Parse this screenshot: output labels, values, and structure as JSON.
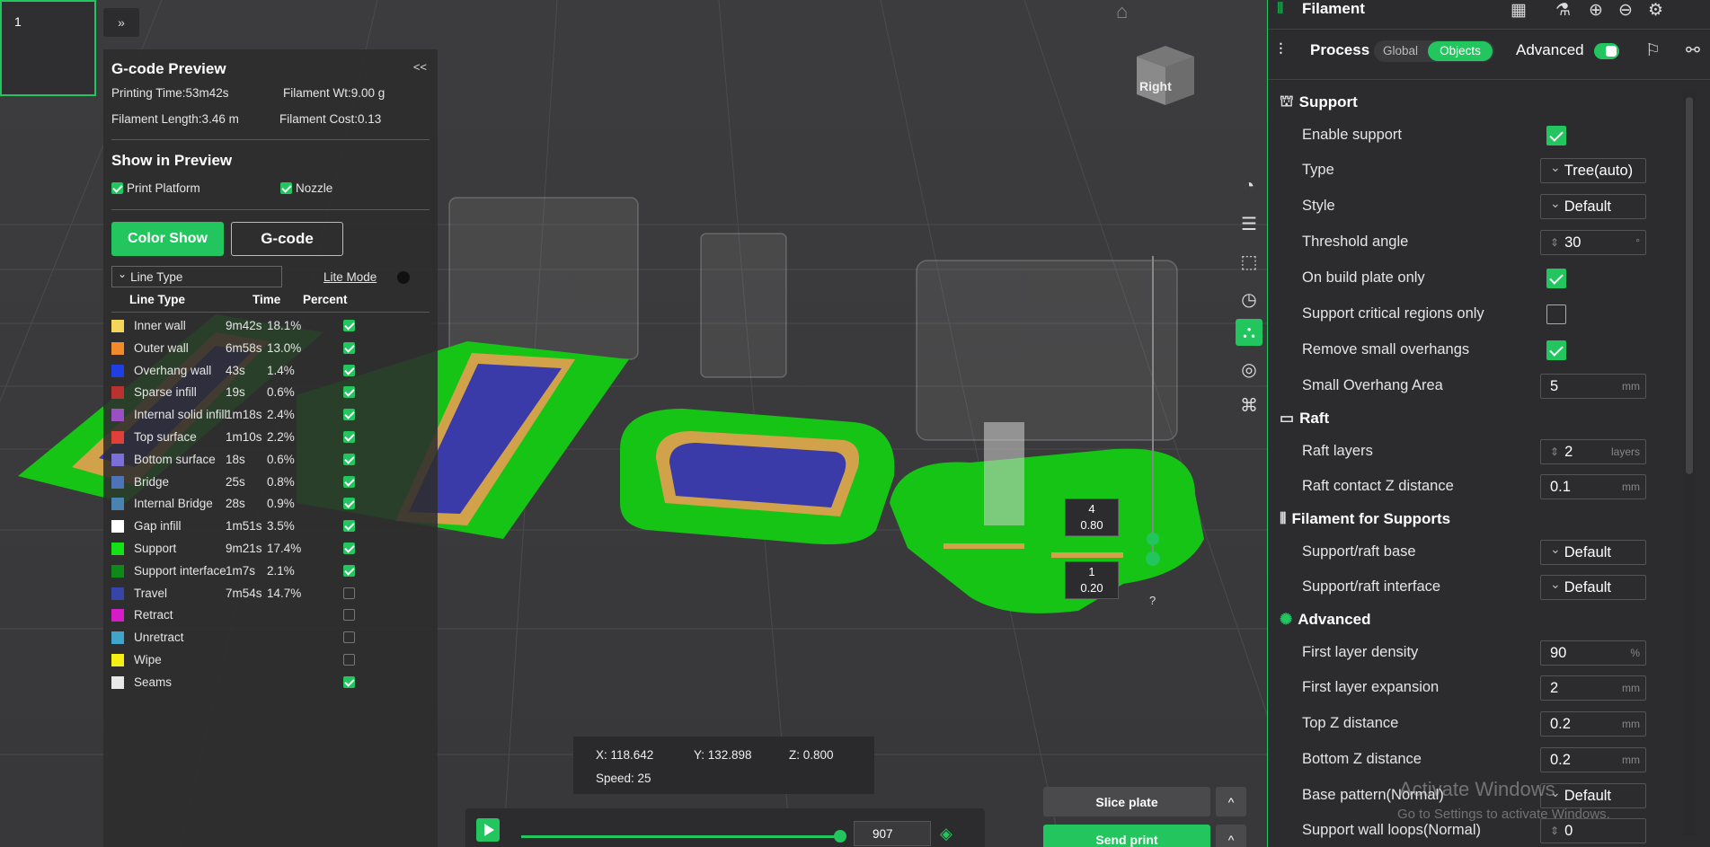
{
  "thumb": {
    "number": "1"
  },
  "collapse_left": "»",
  "preview": {
    "title": "G-code Preview",
    "collapse": "<<",
    "printing_time": "Printing Time:53m42s",
    "filament_wt": "Filament Wt:9.00 g",
    "filament_length": "Filament Length:3.46 m",
    "filament_cost": "Filament Cost:0.13",
    "show_in_preview": "Show in Preview",
    "print_platform": "Print Platform",
    "nozzle": "Nozzle",
    "color_show": "Color Show",
    "gcode": "G-code",
    "line_type_select": "Line Type",
    "lite_mode": "Lite Mode",
    "col_line_type": "Line Type",
    "col_time": "Time",
    "col_percent": "Percent",
    "rows": [
      {
        "name": "Inner wall",
        "time": "9m42s",
        "percent": "18.1%",
        "color": "#f4d75a",
        "checked": true
      },
      {
        "name": "Outer wall",
        "time": "6m58s",
        "percent": "13.0%",
        "color": "#f08a2a",
        "checked": true
      },
      {
        "name": "Overhang wall",
        "time": "43s",
        "percent": "1.4%",
        "color": "#1f3fe0",
        "checked": true
      },
      {
        "name": "Sparse infill",
        "time": "19s",
        "percent": "0.6%",
        "color": "#b8322f",
        "checked": true
      },
      {
        "name": "Internal solid infill",
        "time": "1m18s",
        "percent": "2.4%",
        "color": "#9a4fc2",
        "checked": true
      },
      {
        "name": "Top surface",
        "time": "1m10s",
        "percent": "2.2%",
        "color": "#e0403a",
        "checked": true
      },
      {
        "name": "Bottom surface",
        "time": "18s",
        "percent": "0.6%",
        "color": "#7b6fd9",
        "checked": true
      },
      {
        "name": "Bridge",
        "time": "25s",
        "percent": "0.8%",
        "color": "#4e73b8",
        "checked": true
      },
      {
        "name": "Internal Bridge",
        "time": "28s",
        "percent": "0.9%",
        "color": "#4a82b0",
        "checked": true
      },
      {
        "name": "Gap infill",
        "time": "1m51s",
        "percent": "3.5%",
        "color": "#ffffff",
        "checked": true
      },
      {
        "name": "Support",
        "time": "9m21s",
        "percent": "17.4%",
        "color": "#16e016",
        "checked": true
      },
      {
        "name": "Support interface",
        "time": "1m7s",
        "percent": "2.1%",
        "color": "#0f8a1a",
        "checked": true
      },
      {
        "name": "Travel",
        "time": "7m54s",
        "percent": "14.7%",
        "color": "#3744a8",
        "checked": false
      },
      {
        "name": "Retract",
        "time": "",
        "percent": "",
        "color": "#d51cc8",
        "checked": false
      },
      {
        "name": "Unretract",
        "time": "",
        "percent": "",
        "color": "#3fa6c9",
        "checked": false
      },
      {
        "name": "Wipe",
        "time": "",
        "percent": "",
        "color": "#f5ef16",
        "checked": false
      },
      {
        "name": "Seams",
        "time": "",
        "percent": "",
        "color": "#e8e8e8",
        "checked": true
      }
    ]
  },
  "layer_top": {
    "index": "4",
    "height": "0.80"
  },
  "layer_bottom": {
    "index": "1",
    "height": "0.20"
  },
  "question": "?",
  "cube_label": "Right",
  "coords": {
    "x": "X: 118.642",
    "y": "Y: 132.898",
    "z": "Z: 0.800",
    "speed": "Speed: 25"
  },
  "slider": {
    "layer": "907",
    "progress": 1.0
  },
  "buttons": {
    "slice": "Slice plate",
    "send": "Send print",
    "caret": "^"
  },
  "settings": {
    "filament": "Filament",
    "process": "Process",
    "global": "Global",
    "objects": "Objects",
    "advanced": "Advanced",
    "sections": {
      "support": "Support",
      "raft": "Raft",
      "filament_for_supports": "Filament for Supports",
      "advanced": "Advanced"
    },
    "items": {
      "enable_support": "Enable support",
      "type": "Type",
      "type_val": "Tree(auto)",
      "style": "Style",
      "style_val": "Default",
      "threshold": "Threshold angle",
      "threshold_val": "30",
      "threshold_unit": "°",
      "build_plate": "On build plate only",
      "critical": "Support critical regions only",
      "remove_small": "Remove small overhangs",
      "small_area": "Small Overhang Area",
      "small_area_val": "5",
      "small_area_unit": "mm",
      "raft_layers": "Raft layers",
      "raft_layers_val": "2",
      "raft_layers_unit": "layers",
      "raft_contact": "Raft contact Z distance",
      "raft_contact_val": "0.1",
      "raft_contact_unit": "mm",
      "support_base": "Support/raft base",
      "support_base_val": "Default",
      "support_interface": "Support/raft interface",
      "support_interface_val": "Default",
      "first_density": "First layer density",
      "first_density_val": "90",
      "first_density_unit": "%",
      "first_expansion": "First layer expansion",
      "first_expansion_val": "2",
      "first_expansion_unit": "mm",
      "top_z": "Top Z distance",
      "top_z_val": "0.2",
      "top_z_unit": "mm",
      "bottom_z": "Bottom Z distance",
      "bottom_z_val": "0.2",
      "bottom_z_unit": "mm",
      "base_pattern": "Base pattern(Normal)",
      "base_pattern_val": "Default",
      "support_wall_loops": "Support wall loops(Normal)",
      "support_wall_loops_val": "0"
    }
  },
  "watermark": {
    "line1": "Activate Windows",
    "line2": "Go to Settings to activate Windows."
  }
}
